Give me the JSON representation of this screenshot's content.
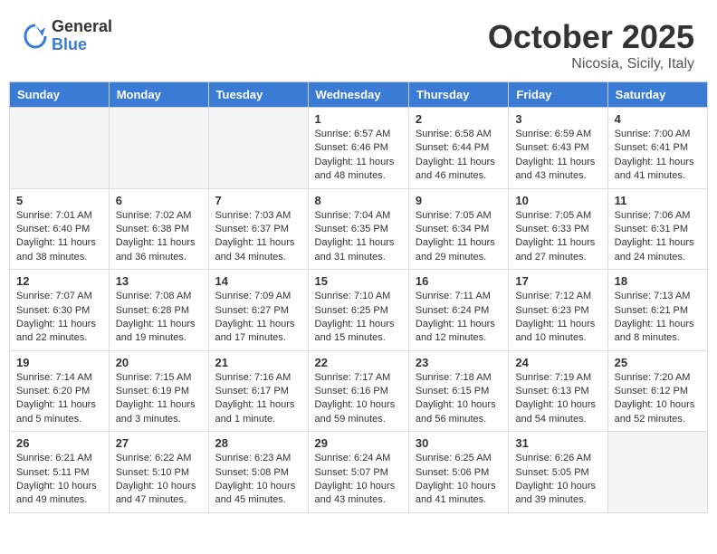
{
  "header": {
    "logo_general": "General",
    "logo_blue": "Blue",
    "month": "October 2025",
    "location": "Nicosia, Sicily, Italy"
  },
  "days_of_week": [
    "Sunday",
    "Monday",
    "Tuesday",
    "Wednesday",
    "Thursday",
    "Friday",
    "Saturday"
  ],
  "weeks": [
    [
      {
        "day": "",
        "info": ""
      },
      {
        "day": "",
        "info": ""
      },
      {
        "day": "",
        "info": ""
      },
      {
        "day": "1",
        "info": "Sunrise: 6:57 AM\nSunset: 6:46 PM\nDaylight: 11 hours\nand 48 minutes."
      },
      {
        "day": "2",
        "info": "Sunrise: 6:58 AM\nSunset: 6:44 PM\nDaylight: 11 hours\nand 46 minutes."
      },
      {
        "day": "3",
        "info": "Sunrise: 6:59 AM\nSunset: 6:43 PM\nDaylight: 11 hours\nand 43 minutes."
      },
      {
        "day": "4",
        "info": "Sunrise: 7:00 AM\nSunset: 6:41 PM\nDaylight: 11 hours\nand 41 minutes."
      }
    ],
    [
      {
        "day": "5",
        "info": "Sunrise: 7:01 AM\nSunset: 6:40 PM\nDaylight: 11 hours\nand 38 minutes."
      },
      {
        "day": "6",
        "info": "Sunrise: 7:02 AM\nSunset: 6:38 PM\nDaylight: 11 hours\nand 36 minutes."
      },
      {
        "day": "7",
        "info": "Sunrise: 7:03 AM\nSunset: 6:37 PM\nDaylight: 11 hours\nand 34 minutes."
      },
      {
        "day": "8",
        "info": "Sunrise: 7:04 AM\nSunset: 6:35 PM\nDaylight: 11 hours\nand 31 minutes."
      },
      {
        "day": "9",
        "info": "Sunrise: 7:05 AM\nSunset: 6:34 PM\nDaylight: 11 hours\nand 29 minutes."
      },
      {
        "day": "10",
        "info": "Sunrise: 7:05 AM\nSunset: 6:33 PM\nDaylight: 11 hours\nand 27 minutes."
      },
      {
        "day": "11",
        "info": "Sunrise: 7:06 AM\nSunset: 6:31 PM\nDaylight: 11 hours\nand 24 minutes."
      }
    ],
    [
      {
        "day": "12",
        "info": "Sunrise: 7:07 AM\nSunset: 6:30 PM\nDaylight: 11 hours\nand 22 minutes."
      },
      {
        "day": "13",
        "info": "Sunrise: 7:08 AM\nSunset: 6:28 PM\nDaylight: 11 hours\nand 19 minutes."
      },
      {
        "day": "14",
        "info": "Sunrise: 7:09 AM\nSunset: 6:27 PM\nDaylight: 11 hours\nand 17 minutes."
      },
      {
        "day": "15",
        "info": "Sunrise: 7:10 AM\nSunset: 6:25 PM\nDaylight: 11 hours\nand 15 minutes."
      },
      {
        "day": "16",
        "info": "Sunrise: 7:11 AM\nSunset: 6:24 PM\nDaylight: 11 hours\nand 12 minutes."
      },
      {
        "day": "17",
        "info": "Sunrise: 7:12 AM\nSunset: 6:23 PM\nDaylight: 11 hours\nand 10 minutes."
      },
      {
        "day": "18",
        "info": "Sunrise: 7:13 AM\nSunset: 6:21 PM\nDaylight: 11 hours\nand 8 minutes."
      }
    ],
    [
      {
        "day": "19",
        "info": "Sunrise: 7:14 AM\nSunset: 6:20 PM\nDaylight: 11 hours\nand 5 minutes."
      },
      {
        "day": "20",
        "info": "Sunrise: 7:15 AM\nSunset: 6:19 PM\nDaylight: 11 hours\nand 3 minutes."
      },
      {
        "day": "21",
        "info": "Sunrise: 7:16 AM\nSunset: 6:17 PM\nDaylight: 11 hours\nand 1 minute."
      },
      {
        "day": "22",
        "info": "Sunrise: 7:17 AM\nSunset: 6:16 PM\nDaylight: 10 hours\nand 59 minutes."
      },
      {
        "day": "23",
        "info": "Sunrise: 7:18 AM\nSunset: 6:15 PM\nDaylight: 10 hours\nand 56 minutes."
      },
      {
        "day": "24",
        "info": "Sunrise: 7:19 AM\nSunset: 6:13 PM\nDaylight: 10 hours\nand 54 minutes."
      },
      {
        "day": "25",
        "info": "Sunrise: 7:20 AM\nSunset: 6:12 PM\nDaylight: 10 hours\nand 52 minutes."
      }
    ],
    [
      {
        "day": "26",
        "info": "Sunrise: 6:21 AM\nSunset: 5:11 PM\nDaylight: 10 hours\nand 49 minutes."
      },
      {
        "day": "27",
        "info": "Sunrise: 6:22 AM\nSunset: 5:10 PM\nDaylight: 10 hours\nand 47 minutes."
      },
      {
        "day": "28",
        "info": "Sunrise: 6:23 AM\nSunset: 5:08 PM\nDaylight: 10 hours\nand 45 minutes."
      },
      {
        "day": "29",
        "info": "Sunrise: 6:24 AM\nSunset: 5:07 PM\nDaylight: 10 hours\nand 43 minutes."
      },
      {
        "day": "30",
        "info": "Sunrise: 6:25 AM\nSunset: 5:06 PM\nDaylight: 10 hours\nand 41 minutes."
      },
      {
        "day": "31",
        "info": "Sunrise: 6:26 AM\nSunset: 5:05 PM\nDaylight: 10 hours\nand 39 minutes."
      },
      {
        "day": "",
        "info": ""
      }
    ]
  ]
}
